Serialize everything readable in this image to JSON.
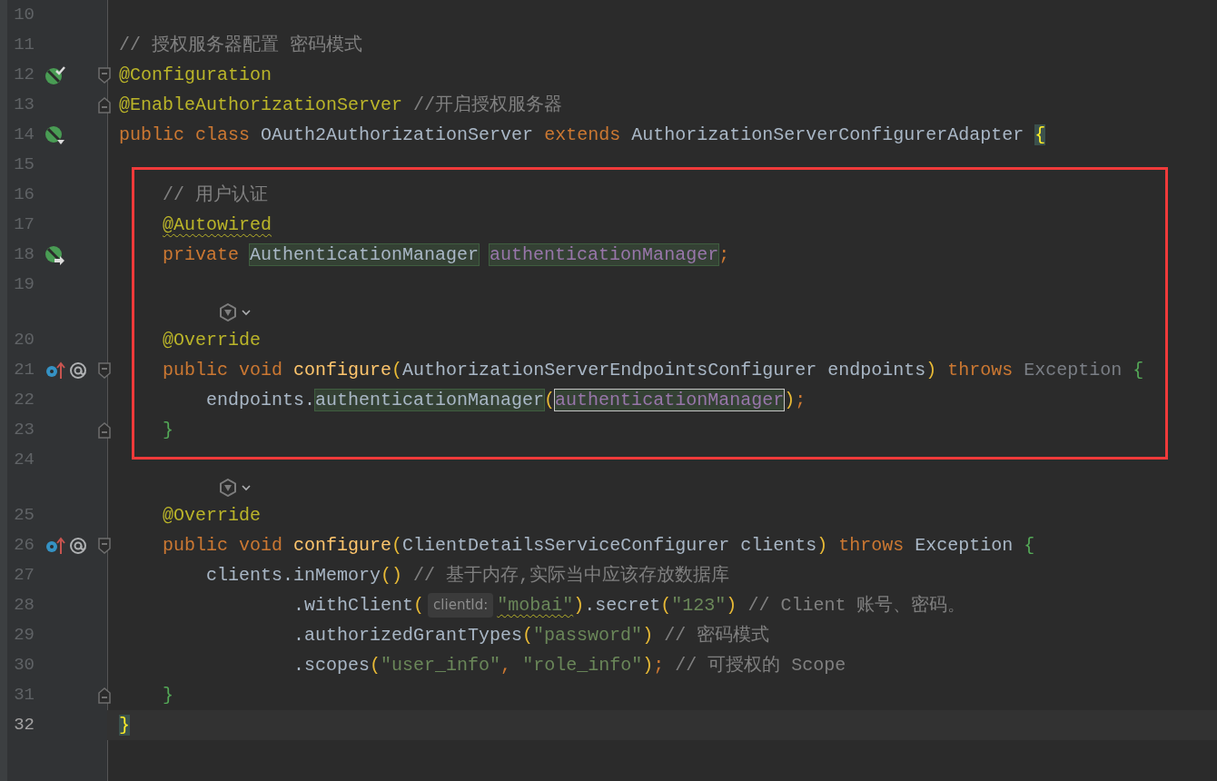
{
  "editor": {
    "rows": [
      {
        "kind": "code",
        "number": "10",
        "tokens": []
      },
      {
        "kind": "code",
        "number": "11",
        "tokens": [
          {
            "text": "// 授权服务器配置 密码模式",
            "kind": "comment"
          }
        ]
      },
      {
        "kind": "code",
        "number": "12",
        "gutter_icons": [
          {
            "kind": "bean-check"
          }
        ],
        "fold_start": true,
        "tokens": [
          {
            "text": "@Configuration",
            "kind": "annotation"
          }
        ]
      },
      {
        "kind": "code",
        "number": "13",
        "fold_end": true,
        "tokens": [
          {
            "text": "@EnableAuthorizationServer",
            "kind": "annotation"
          },
          {
            "text": " //开启授权服务器",
            "kind": "comment"
          }
        ]
      },
      {
        "kind": "code",
        "number": "14",
        "gutter_icons": [
          {
            "kind": "bean-down"
          }
        ],
        "tokens": [
          {
            "text": "public",
            "kind": "keyword"
          },
          {
            "text": " class",
            "kind": "keyword"
          },
          {
            "text": " OAuth2AuthorizationServer ",
            "kind": "plain"
          },
          {
            "text": "extends",
            "kind": "keyword"
          },
          {
            "text": " AuthorizationServerConfigurerAdapter ",
            "kind": "plain"
          },
          {
            "text": "{",
            "kind": "brace-match"
          }
        ]
      },
      {
        "kind": "code",
        "number": "15",
        "tokens": []
      },
      {
        "kind": "box",
        "rows": [
          {
            "kind": "code",
            "number": "16",
            "tokens": [
              {
                "text": "    // 用户认证",
                "kind": "comment"
              }
            ]
          },
          {
            "kind": "code",
            "number": "17",
            "tokens": [
              {
                "text": "    @Autowired",
                "kind": "annotation",
                "squiggle": true
              }
            ]
          },
          {
            "kind": "code",
            "number": "18",
            "gutter_icons": [
              {
                "kind": "bean-arrow"
              }
            ],
            "tokens": [
              {
                "text": "    private ",
                "kind": "keyword"
              },
              {
                "text": "AuthenticationManager",
                "kind": "plain",
                "usage_highlight": true
              },
              {
                "text": " authenticationManager",
                "kind": "field",
                "usage_highlight": true
              },
              {
                "text": ";",
                "kind": "keyword"
              }
            ]
          },
          {
            "kind": "code",
            "number": "19",
            "tokens": []
          },
          {
            "kind": "inlay"
          },
          {
            "kind": "code",
            "number": "20",
            "tokens": [
              {
                "text": "    @Override",
                "kind": "annotation"
              }
            ]
          },
          {
            "kind": "code",
            "number": "21",
            "gutter_icons": [
              {
                "kind": "override"
              },
              {
                "kind": "at"
              }
            ],
            "fold_start": true,
            "tokens": [
              {
                "text": "    public",
                "kind": "keyword"
              },
              {
                "text": " void ",
                "kind": "keyword"
              },
              {
                "text": "configure",
                "kind": "method"
              },
              {
                "text": "(",
                "kind": "paren"
              },
              {
                "text": "AuthorizationServerEndpointsConfigurer endpoints",
                "kind": "plain"
              },
              {
                "text": ")",
                "kind": "paren"
              },
              {
                "text": " throws ",
                "kind": "keyword"
              },
              {
                "text": "Exception ",
                "kind": "dim"
              },
              {
                "text": "{",
                "kind": "brace"
              }
            ]
          },
          {
            "kind": "code",
            "number": "22",
            "tokens": [
              {
                "text": "        endpoints.",
                "kind": "plain"
              },
              {
                "text": "authenticationManager",
                "kind": "plain",
                "usage_highlight": true
              },
              {
                "text": "(",
                "kind": "paren"
              },
              {
                "text": "authenticationManager",
                "kind": "field",
                "usage_highlight": true,
                "caret_highlight": true
              },
              {
                "text": ")",
                "kind": "paren"
              },
              {
                "text": ";",
                "kind": "keyword"
              }
            ]
          },
          {
            "kind": "code",
            "number": "23",
            "fold_end": true,
            "tokens": [
              {
                "text": "    }",
                "kind": "brace"
              }
            ]
          }
        ]
      },
      {
        "kind": "code",
        "number": "24",
        "tokens": []
      },
      {
        "kind": "inlay"
      },
      {
        "kind": "code",
        "number": "25",
        "tokens": [
          {
            "text": "    @Override",
            "kind": "annotation"
          }
        ]
      },
      {
        "kind": "code",
        "number": "26",
        "gutter_icons": [
          {
            "kind": "override"
          },
          {
            "kind": "at"
          }
        ],
        "fold_start": true,
        "tokens": [
          {
            "text": "    public",
            "kind": "keyword"
          },
          {
            "text": " void ",
            "kind": "keyword"
          },
          {
            "text": "configure",
            "kind": "method"
          },
          {
            "text": "(",
            "kind": "paren"
          },
          {
            "text": "ClientDetailsServiceConfigurer clients",
            "kind": "plain"
          },
          {
            "text": ")",
            "kind": "paren"
          },
          {
            "text": " throws",
            "kind": "keyword"
          },
          {
            "text": " Exception ",
            "kind": "plain"
          },
          {
            "text": "{",
            "kind": "brace"
          }
        ]
      },
      {
        "kind": "code",
        "number": "27",
        "tokens": [
          {
            "text": "        clients.inMemory",
            "kind": "plain"
          },
          {
            "text": "()",
            "kind": "paren"
          },
          {
            "text": " // 基于内存,实际当中应该存放数据库",
            "kind": "comment"
          }
        ]
      },
      {
        "kind": "code",
        "number": "28",
        "tokens": [
          {
            "text": "                .withClient",
            "kind": "plain"
          },
          {
            "text": "(",
            "kind": "paren"
          },
          {
            "text": "clientId:",
            "kind": "hint"
          },
          {
            "text": "\"mobai\"",
            "kind": "string",
            "squiggle": true
          },
          {
            "text": ")",
            "kind": "paren"
          },
          {
            "text": ".secret",
            "kind": "plain"
          },
          {
            "text": "(",
            "kind": "paren"
          },
          {
            "text": "\"123\"",
            "kind": "string"
          },
          {
            "text": ")",
            "kind": "paren"
          },
          {
            "text": " // Client 账号、密码。",
            "kind": "comment"
          }
        ]
      },
      {
        "kind": "code",
        "number": "29",
        "tokens": [
          {
            "text": "                .authorizedGrantTypes",
            "kind": "plain"
          },
          {
            "text": "(",
            "kind": "paren"
          },
          {
            "text": "\"password\"",
            "kind": "string"
          },
          {
            "text": ")",
            "kind": "paren"
          },
          {
            "text": " // 密码模式",
            "kind": "comment"
          }
        ]
      },
      {
        "kind": "code",
        "number": "30",
        "tokens": [
          {
            "text": "                .scopes",
            "kind": "plain"
          },
          {
            "text": "(",
            "kind": "paren"
          },
          {
            "text": "\"user_info\"",
            "kind": "string"
          },
          {
            "text": ",",
            "kind": "keyword"
          },
          {
            "text": " \"role_info\"",
            "kind": "string"
          },
          {
            "text": ")",
            "kind": "paren"
          },
          {
            "text": ";",
            "kind": "keyword"
          },
          {
            "text": " // 可授权的 Scope",
            "kind": "comment"
          }
        ]
      },
      {
        "kind": "code",
        "number": "31",
        "fold_end": true,
        "tokens": [
          {
            "text": "    }",
            "kind": "brace"
          }
        ]
      },
      {
        "kind": "code",
        "number": "32",
        "current": true,
        "tokens": [
          {
            "text": "}",
            "kind": "brace-current"
          }
        ]
      }
    ]
  }
}
